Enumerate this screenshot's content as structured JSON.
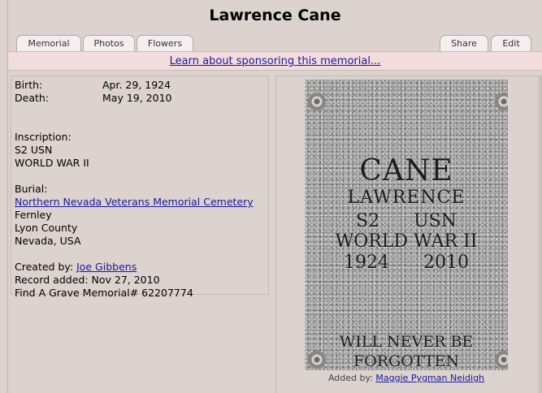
{
  "title": "Lawrence Cane",
  "tabs_left": [
    "Memorial",
    "Photos",
    "Flowers"
  ],
  "tabs_right": [
    "Share",
    "Edit"
  ],
  "banner": {
    "text": "Learn about sponsoring this memorial..."
  },
  "info": {
    "birth_label": "Birth:",
    "birth_value": "Apr. 29, 1924",
    "death_label": "Death:",
    "death_value": "May 19, 2010",
    "inscription_label": "Inscription:",
    "inscription_lines": [
      "S2 USN",
      "WORLD WAR II"
    ],
    "burial_label": "Burial:",
    "cemetery": "Northern Nevada Veterans Memorial Cemetery",
    "place_lines": [
      "Fernley",
      "Lyon County",
      "Nevada, USA"
    ],
    "created_by_label": "Created by:",
    "created_by": "Joe Gibbens",
    "record_added": "Record added: Nov 27, 2010",
    "memorial_id": "Find A Grave Memorial# 62207774"
  },
  "headstone": {
    "lines": [
      "CANE",
      "LAWRENCE",
      "S2      USN",
      "WORLD WAR II",
      "1924      2010",
      "WILL NEVER BE",
      "FORGOTTEN"
    ]
  },
  "photo_caption": {
    "prefix": "Added by:",
    "author": "Maggie Pygman Neidigh"
  }
}
